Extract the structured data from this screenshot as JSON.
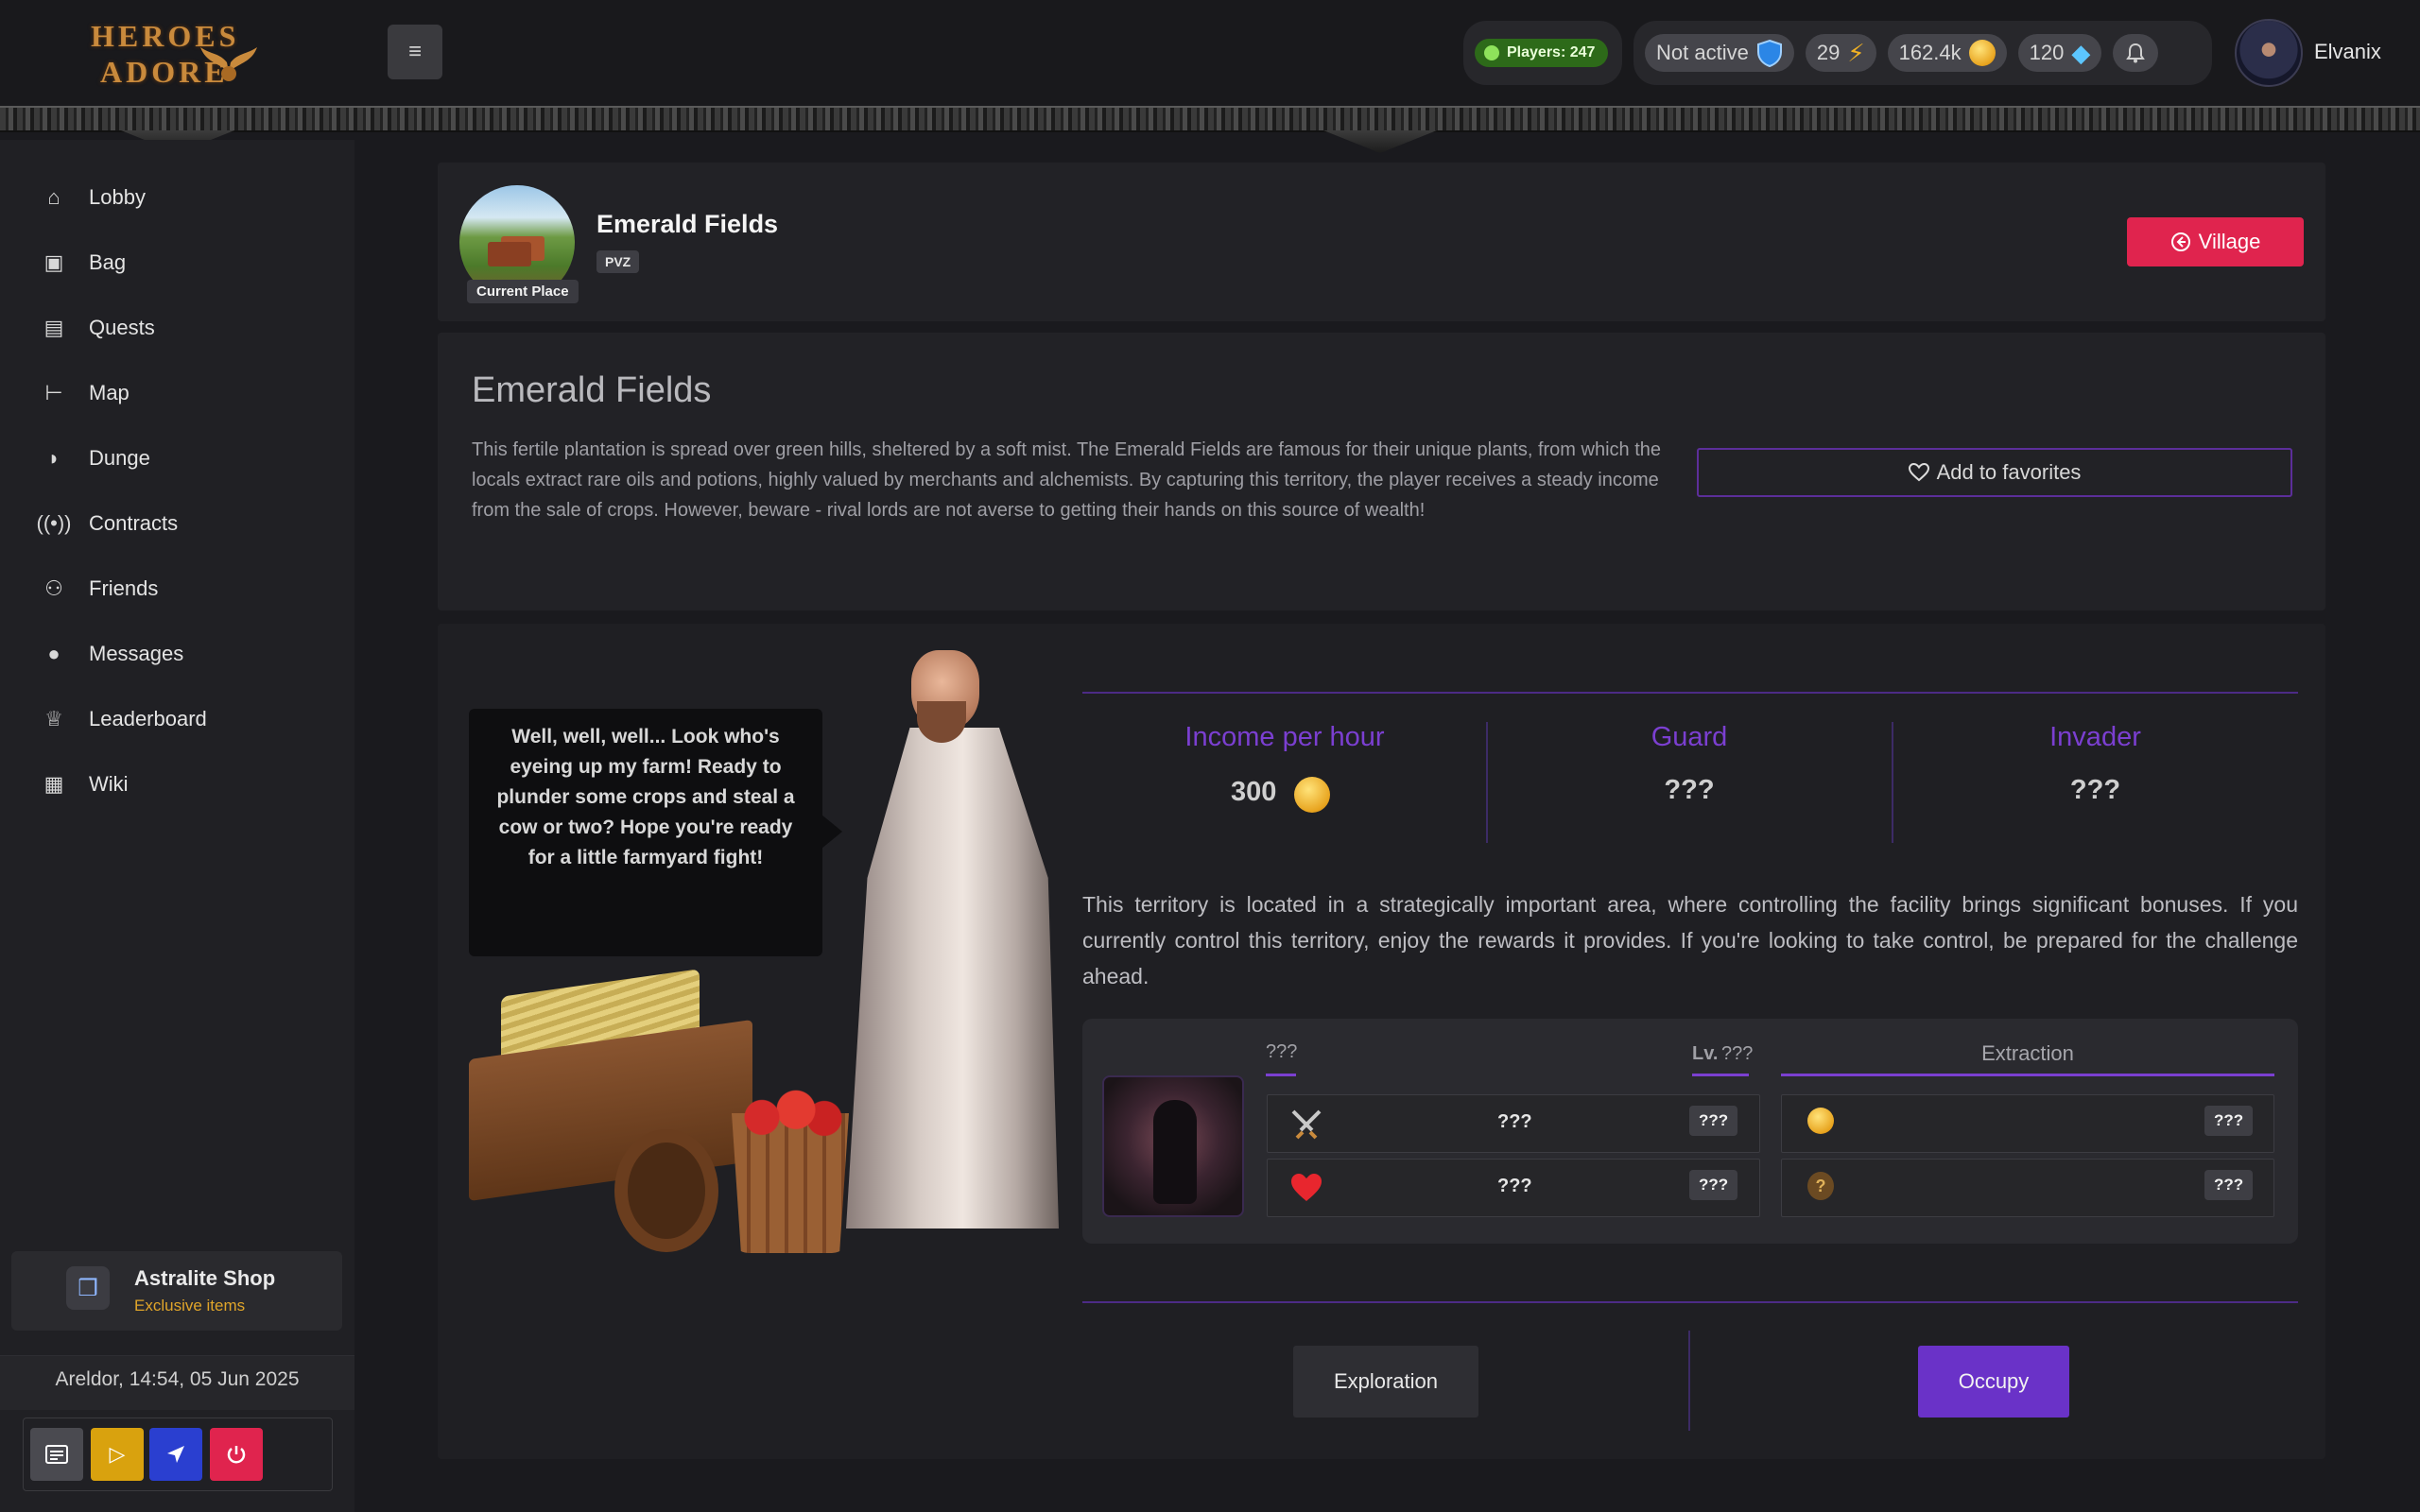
{
  "header": {
    "logo_line1": "HEROES",
    "logo_line2": "ADORE",
    "menu_toggle": "≡",
    "players": "Players: 247",
    "status": "Not active",
    "energy": "29",
    "gold": "162.4k",
    "crystals": "120",
    "username": "Elvanix"
  },
  "sidebar": {
    "items": [
      {
        "label": "Lobby",
        "icon": "home-icon"
      },
      {
        "label": "Bag",
        "icon": "bag-icon"
      },
      {
        "label": "Quests",
        "icon": "book-icon"
      },
      {
        "label": "Map",
        "icon": "signpost-icon"
      },
      {
        "label": "Dunge",
        "icon": "shield-icon"
      },
      {
        "label": "Contracts",
        "icon": "broadcast-icon"
      },
      {
        "label": "Friends",
        "icon": "people-icon"
      },
      {
        "label": "Messages",
        "icon": "chat-icon"
      },
      {
        "label": "Leaderboard",
        "icon": "trophy-icon"
      },
      {
        "label": "Wiki",
        "icon": "wiki-icon"
      }
    ],
    "shop": {
      "title": "Astralite Shop",
      "subtitle": "Exclusive items"
    },
    "clock": "Areldor, 14:54, 05 Jun 2025"
  },
  "place": {
    "name": "Emerald Fields",
    "badge": "Current Place",
    "mode": "PVZ",
    "village_button": "Village"
  },
  "info": {
    "title": "Emerald Fields",
    "description": "This fertile plantation is spread over green hills, sheltered by a soft mist. The Emerald Fields are famous for their unique plants, from which the locals extract rare oils and potions, highly valued by merchants and alchemists. By capturing this territory, the player receives a steady income from the sale of crops. However, beware - rival lords are not averse to getting their hands on this source of wealth!",
    "favorite_button": "Add to favorites"
  },
  "npc": {
    "speech": "Well, well, well... Look who's eyeing up my farm! Ready to plunder some crops and steal a cow or two? Hope you're ready for a little farmyard fight!"
  },
  "stats": {
    "income_label": "Income per hour",
    "income_value": "300",
    "guard_label": "Guard",
    "guard_value": "???",
    "invader_label": "Invader",
    "invader_value": "???"
  },
  "territory_text": "This territory is located in a strategically important area, where controlling the facility brings significant bonuses. If you currently control this territory, enjoy the rewards it provides. If you're looking to take control, be prepared for the challenge ahead.",
  "guard_panel": {
    "name": "???",
    "level_prefix": "Lv.",
    "level": "???",
    "attack_value": "???",
    "attack_tag": "???",
    "health_value": "???",
    "health_tag": "???",
    "extraction_title": "Extraction",
    "extraction_gold_tag": "???",
    "extraction_unknown_tag": "???"
  },
  "actions": {
    "explore": "Exploration",
    "occupy": "Occupy"
  }
}
